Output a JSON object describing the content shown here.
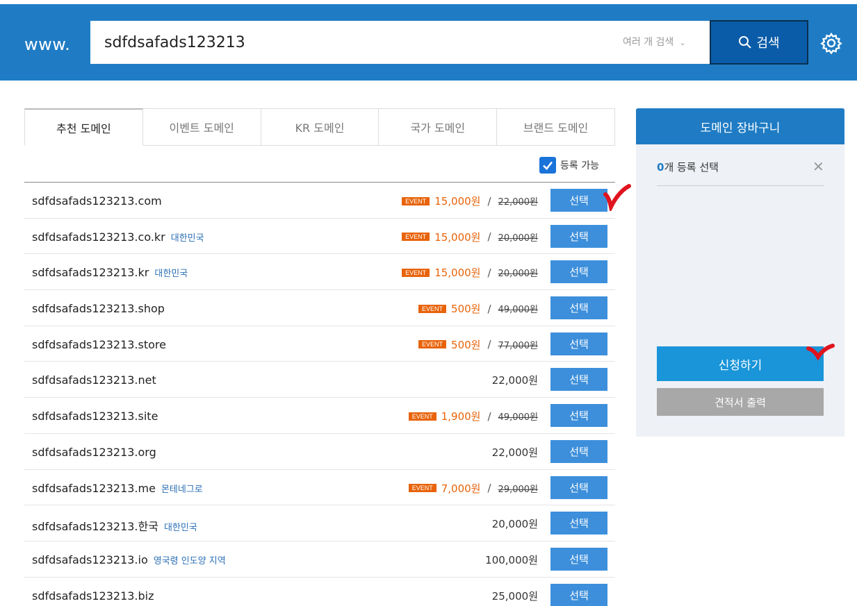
{
  "header": {
    "prefix": "www.",
    "search_value": "sdfdsafads123213",
    "multi_search_label": "여러 개 검색",
    "search_button_label": "검색",
    "bg_color": "#1f7cc4"
  },
  "tabs": [
    {
      "label": "추천 도메인",
      "active": true
    },
    {
      "label": "이벤트 도메인",
      "active": false
    },
    {
      "label": "KR 도메인",
      "active": false
    },
    {
      "label": "국가 도메인",
      "active": false
    },
    {
      "label": "브랜드 도메인",
      "active": false
    }
  ],
  "filter": {
    "available_label": "등록 가능",
    "checked": true
  },
  "domains": [
    {
      "name": "sdfdsafads123213.com",
      "country": "",
      "event": true,
      "badge": "EVENT",
      "price": "15,000원",
      "original": "22,000원",
      "button": "선택"
    },
    {
      "name": "sdfdsafads123213.co.kr",
      "country": "대한민국",
      "event": true,
      "badge": "EVENT",
      "price": "15,000원",
      "original": "20,000원",
      "button": "선택"
    },
    {
      "name": "sdfdsafads123213.kr",
      "country": "대한민국",
      "event": true,
      "badge": "EVENT",
      "price": "15,000원",
      "original": "20,000원",
      "button": "선택"
    },
    {
      "name": "sdfdsafads123213.shop",
      "country": "",
      "event": true,
      "badge": "EVENT",
      "price": "500원",
      "original": "49,000원",
      "button": "선택"
    },
    {
      "name": "sdfdsafads123213.store",
      "country": "",
      "event": true,
      "badge": "EVENT",
      "price": "500원",
      "original": "77,000원",
      "button": "선택"
    },
    {
      "name": "sdfdsafads123213.net",
      "country": "",
      "event": false,
      "price": "22,000원",
      "button": "선택"
    },
    {
      "name": "sdfdsafads123213.site",
      "country": "",
      "event": true,
      "badge": "EVENT",
      "price": "1,900원",
      "original": "49,000원",
      "button": "선택"
    },
    {
      "name": "sdfdsafads123213.org",
      "country": "",
      "event": false,
      "price": "22,000원",
      "button": "선택"
    },
    {
      "name": "sdfdsafads123213.me",
      "country": "몬테네그로",
      "event": true,
      "badge": "EVENT",
      "price": "7,000원",
      "original": "29,000원",
      "button": "선택"
    },
    {
      "name": "sdfdsafads123213.한국",
      "country": "대한민국",
      "event": false,
      "price": "20,000원",
      "button": "선택"
    },
    {
      "name": "sdfdsafads123213.io",
      "country": "영국령 인도양 지역",
      "event": false,
      "price": "100,000원",
      "button": "선택"
    },
    {
      "name": "sdfdsafads123213.biz",
      "country": "",
      "event": false,
      "price": "25,000원",
      "button": "선택"
    }
  ],
  "cart": {
    "title": "도메인 장바구니",
    "count": "0",
    "count_suffix": "개 등록 선택",
    "apply_label": "신청하기",
    "quote_label": "견적서 출력"
  },
  "colors": {
    "accent": "#1f7cc4",
    "event": "#e8630a",
    "button": "#3d8fdb",
    "mark": "#e0141e"
  }
}
